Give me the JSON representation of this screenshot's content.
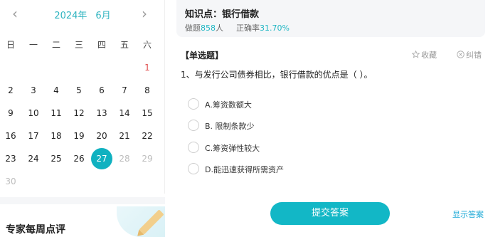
{
  "calendar": {
    "year_label": "2024年",
    "month_label": "6月",
    "prev_label": "‹",
    "next_label": "›",
    "weekdays": [
      "日",
      "一",
      "二",
      "三",
      "四",
      "五",
      "六"
    ],
    "weeks": [
      [
        null,
        null,
        null,
        null,
        null,
        null,
        "1"
      ],
      [
        "2",
        "3",
        "4",
        "5",
        "6",
        "7",
        "8"
      ],
      [
        "9",
        "10",
        "11",
        "12",
        "13",
        "14",
        "15"
      ],
      [
        "16",
        "17",
        "18",
        "19",
        "20",
        "21",
        "22"
      ],
      [
        "23",
        "24",
        "25",
        "26",
        "27",
        "28",
        "29"
      ],
      [
        "30",
        null,
        null,
        null,
        null,
        null,
        null
      ]
    ],
    "today": "27",
    "highlight_red": [
      "1"
    ],
    "dimmed": [
      "28",
      "29",
      "30"
    ],
    "colors": {
      "accent": "#10b1c0",
      "title": "#2fb4c0",
      "red": "#e04a4a",
      "dim": "#bdbdbd"
    }
  },
  "expert": {
    "title": "专家每周点评"
  },
  "knowledge": {
    "title": "知识点：银行借款",
    "done_prefix": "做题",
    "done_count": "858",
    "done_suffix": "人",
    "accuracy_prefix": "正确率",
    "accuracy_value": "31.70%"
  },
  "question": {
    "type_label": "【单选题】",
    "favorite_label": "收藏",
    "report_label": "纠错",
    "text": "1、与发行公司债券相比，银行借款的优点是（   ）。",
    "options": [
      {
        "label": "A.筹资数额大"
      },
      {
        "label": "B. 限制条款少"
      },
      {
        "label": "C.筹资弹性较大"
      },
      {
        "label": "D.能迅速获得所需资产"
      }
    ]
  },
  "actions": {
    "submit_label": "提交答案",
    "show_answer_label": "显示答案"
  },
  "icons": {
    "prev": "chevron-left-icon",
    "next": "chevron-right-icon",
    "favorite": "star-icon",
    "report": "close-circle-icon",
    "deco": "pencil-icon"
  }
}
